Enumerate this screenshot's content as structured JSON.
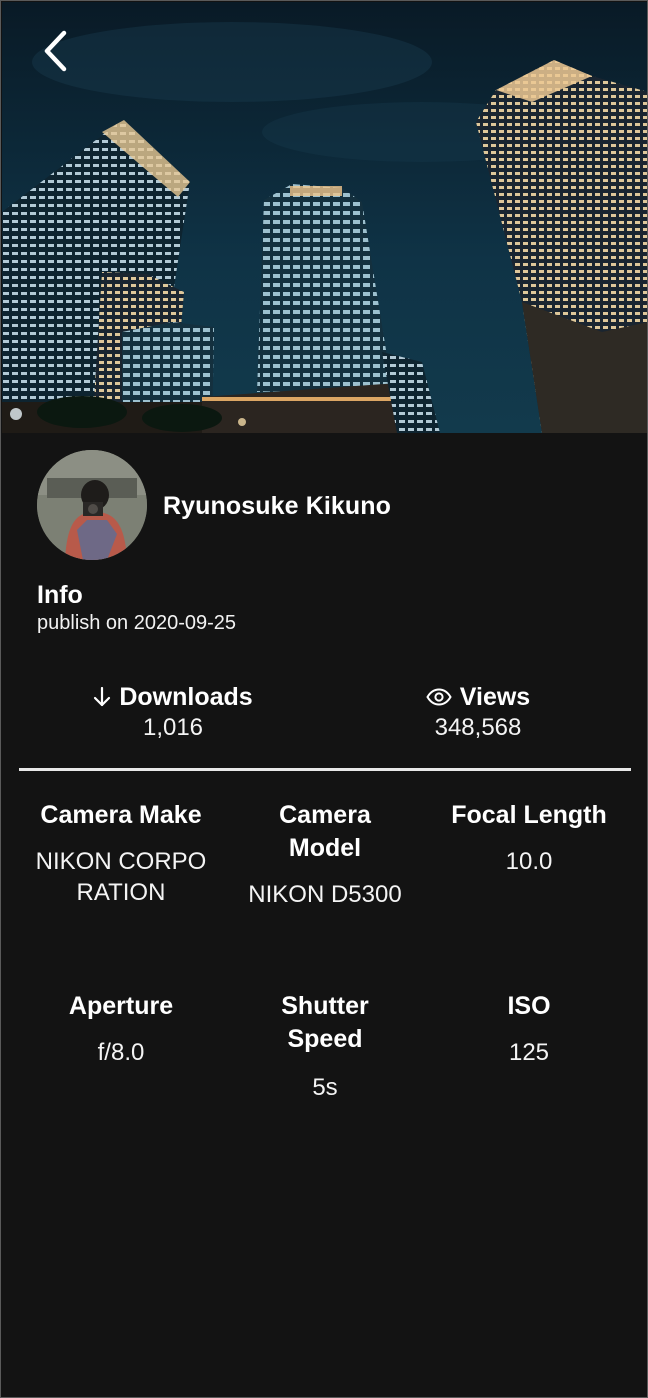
{
  "header": {
    "back_icon": "chevron-left-icon"
  },
  "author": {
    "name": "Ryunosuke Kikuno"
  },
  "info": {
    "title": "Info",
    "published": "publish on 2020-09-25"
  },
  "stats": {
    "downloads": {
      "label": "Downloads",
      "value": "1,016",
      "icon": "arrow-down-icon"
    },
    "views": {
      "label": "Views",
      "value": "348,568",
      "icon": "eye-icon"
    }
  },
  "exif": {
    "camera_make": {
      "label": "Camera Make",
      "value": "NIKON CORPORATION"
    },
    "camera_model": {
      "label": "Camera Model",
      "value": "NIKON D5300"
    },
    "focal_length": {
      "label": "Focal Length",
      "value": "10.0"
    },
    "aperture": {
      "label": "Aperture",
      "value": "f/8.0"
    },
    "shutter_speed": {
      "label": "Shutter Speed",
      "value": "5s"
    },
    "iso": {
      "label": "ISO",
      "value": "125"
    }
  },
  "colors": {
    "background": "#131313",
    "text": "#ffffff",
    "divider": "#e8e8e8",
    "sky": "#0d2a3d",
    "window_light": "#f3d9a6"
  }
}
